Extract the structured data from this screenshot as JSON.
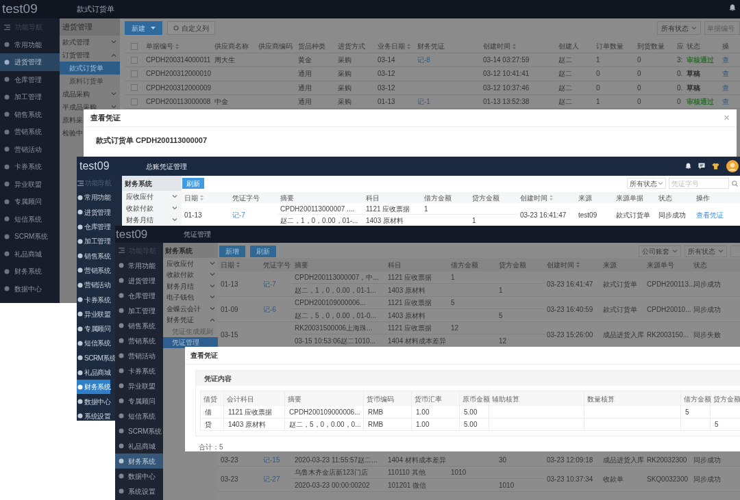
{
  "order_window": {
    "logo": "test09",
    "title": "款式订货单",
    "sidebar": [
      {
        "label": "功能导航",
        "kind": "toggle"
      },
      {
        "label": "常用功能",
        "kind": "link",
        "selected": false
      },
      {
        "label": "进货管理",
        "kind": "link",
        "selected": true
      },
      {
        "label": "仓库管理",
        "kind": "link",
        "selected": false
      },
      {
        "label": "加工管理",
        "kind": "link",
        "selected": false
      },
      {
        "label": "销售系统",
        "kind": "link",
        "selected": false
      },
      {
        "label": "营销系统",
        "kind": "link",
        "selected": false
      },
      {
        "label": "营销活动",
        "kind": "link",
        "selected": false
      },
      {
        "label": "卡券系统",
        "kind": "link",
        "selected": false
      },
      {
        "label": "异业联盟",
        "kind": "link",
        "selected": false
      },
      {
        "label": "专属顾问",
        "kind": "link",
        "selected": false
      },
      {
        "label": "短信系统",
        "kind": "link",
        "selected": false
      },
      {
        "label": "SCRM系统",
        "kind": "link",
        "selected": false
      },
      {
        "label": "礼品商城",
        "kind": "link",
        "selected": false
      },
      {
        "label": "财务系统",
        "kind": "link",
        "selected": false
      },
      {
        "label": "数据中心",
        "kind": "link",
        "selected": false
      }
    ],
    "submenu": {
      "header": "进货管理",
      "items": [
        {
          "label": "款式管理",
          "kind": "group",
          "expanded": false
        },
        {
          "label": "订货管理",
          "kind": "group",
          "expanded": true,
          "children": [
            {
              "label": "款式订货单",
              "selected": true
            },
            {
              "label": "原料订货单",
              "selected": false
            }
          ]
        },
        {
          "label": "成品采购",
          "kind": "group",
          "expanded": false
        },
        {
          "label": "半成品采购",
          "kind": "group",
          "expanded": false
        },
        {
          "label": "原料采",
          "kind": "link",
          "selected": false
        },
        {
          "label": "检验中",
          "kind": "link",
          "selected": false
        }
      ]
    },
    "new_button": "新建",
    "columns_button": "自定义列",
    "status_filter": "所有状态",
    "search_placeholder": "单据编号",
    "table": {
      "select_all_checked": false,
      "columns": [
        {
          "label": "单据编号",
          "sortable": true,
          "kind": "text"
        },
        {
          "label": "供应商名称",
          "sortable": false,
          "kind": "text"
        },
        {
          "label": "供应商编码",
          "sortable": false
        },
        {
          "label": "货品种类",
          "sortable": false,
          "kind": "text"
        },
        {
          "label": "进货方式",
          "sortable": false,
          "kind": "text"
        },
        {
          "label": "业务日期",
          "sortable": true,
          "kind": "text"
        },
        {
          "label": "财务凭证",
          "sortable": false,
          "kind": "link"
        },
        {
          "label": "创建时间",
          "sortable": true,
          "kind": "text"
        },
        {
          "label": "创建人",
          "sortable": false,
          "kind": "text"
        },
        {
          "label": "订单数量",
          "sortable": false,
          "kind": "text"
        },
        {
          "label": "到货数量",
          "sortable": false,
          "kind": "text"
        },
        {
          "label": "应",
          "sortable": false,
          "kind": "text"
        },
        {
          "label": "状态",
          "sortable": false,
          "kind": "status"
        },
        {
          "label": "操",
          "sortable": false,
          "kind": "link"
        }
      ],
      "rows": [
        {
          "checked": false,
          "number": "CPDH200314000011",
          "supplier_name": "周大生",
          "goods_type": "黄金",
          "purchase_mode": "采购",
          "business_date": "03-14",
          "voucher": "记-8",
          "created_at": "03-14 03:27:59",
          "creator": "赵二",
          "order_qty": "1",
          "arrived_qty": "0",
          "column_12": "3:",
          "status": {
            "text": "审核通过",
            "color": "#2f6e2f"
          },
          "column_14": "查"
        },
        {
          "checked": false,
          "number": "CPDH200312000010",
          "goods_type": "通用",
          "purchase_mode": "采购",
          "business_date": "03-12",
          "created_at": "03-12 10:41:41",
          "creator": "赵二",
          "order_qty": "0",
          "arrived_qty": "0",
          "column_12": "0.",
          "status": {
            "text": "草稿",
            "color": "#2e2e2e"
          },
          "column_14": "查"
        },
        {
          "checked": false,
          "number": "CPDH200312000009",
          "goods_type": "通用",
          "purchase_mode": "采购",
          "business_date": "03-12",
          "created_at": "03-12 10:37:46",
          "creator": "赵二",
          "order_qty": "0",
          "arrived_qty": "0",
          "column_12": "0.",
          "status": {
            "text": "草稿",
            "color": "#2e2e2e"
          },
          "column_14": "查"
        },
        {
          "checked": false,
          "number": "CPDH200113000008",
          "supplier_name": "中金",
          "goods_type": "通用",
          "purchase_mode": "采购",
          "business_date": "01-13",
          "voucher": "记-1",
          "created_at": "01-13 13:52:38",
          "creator": "赵二",
          "order_qty": "1",
          "arrived_qty": "0",
          "column_12": "0",
          "status": {
            "text": "审核通过",
            "color": "#2f6e2f"
          },
          "column_14": "查"
        }
      ]
    },
    "dialog": {
      "title": "查看凭证",
      "close": "×",
      "heading": "款式订货单 CPDH200113000007"
    }
  },
  "ledger_window": {
    "logo": "test09",
    "title": "总账凭证管理",
    "sidebar": [
      {
        "label": "功能导航",
        "kind": "toggle"
      },
      {
        "label": "常用功能",
        "kind": "link",
        "selected": false
      },
      {
        "label": "进货管理",
        "kind": "link",
        "selected": false
      },
      {
        "label": "仓库管理",
        "kind": "link",
        "selected": false
      },
      {
        "label": "加工管理",
        "kind": "link",
        "selected": false
      },
      {
        "label": "销售系统",
        "kind": "link",
        "selected": false
      },
      {
        "label": "营销系统",
        "kind": "link",
        "selected": false
      },
      {
        "label": "营销活动",
        "kind": "link",
        "selected": false
      },
      {
        "label": "卡券系统",
        "kind": "link",
        "selected": false
      },
      {
        "label": "异业联盟",
        "kind": "link",
        "selected": false
      },
      {
        "label": "专属顾问",
        "kind": "link",
        "selected": false
      },
      {
        "label": "短信系统",
        "kind": "link",
        "selected": false
      },
      {
        "label": "SCRM系统",
        "kind": "link",
        "selected": false
      },
      {
        "label": "礼品商城",
        "kind": "link",
        "selected": false
      },
      {
        "label": "财务系统",
        "kind": "link",
        "selected": true
      },
      {
        "label": "数据中心",
        "kind": "link",
        "selected": false
      },
      {
        "label": "系统设置",
        "kind": "link",
        "selected": false
      }
    ],
    "submenu": {
      "header": "财务系统",
      "items": [
        {
          "label": "应收应付",
          "kind": "group",
          "expanded": false
        },
        {
          "label": "收款付款",
          "kind": "group",
          "expanded": false
        },
        {
          "label": "财务月结",
          "kind": "group",
          "expanded": false
        }
      ]
    },
    "refresh_button": "刷新",
    "status_filter": "所有状态",
    "search_placeholder": "凭证字号",
    "table": {
      "columns": [
        {
          "label": "日期",
          "sortable": true,
          "kind": "text"
        },
        {
          "label": "凭证字号",
          "sortable": false,
          "kind": "link"
        },
        {
          "label": "摘要",
          "sortable": false,
          "kind": "line"
        },
        {
          "label": "科目",
          "sortable": false,
          "kind": "line"
        },
        {
          "label": "借方金额",
          "sortable": false,
          "kind": "line"
        },
        {
          "label": "贷方金额",
          "sortable": false,
          "kind": "line"
        },
        {
          "label": "创建时间",
          "sortable": true,
          "kind": "text"
        },
        {
          "label": "来源",
          "sortable": false,
          "kind": "text"
        },
        {
          "label": "来源单据",
          "sortable": false,
          "kind": "text"
        },
        {
          "label": "状态",
          "sortable": false,
          "kind": "text"
        },
        {
          "label": "操作",
          "sortable": false,
          "kind": "link"
        }
      ],
      "rows": [
        {
          "date": "01-13",
          "voucher": "记-7",
          "created_at": "03-23 16:41:47",
          "source": "test09",
          "source_doc": "款式订货单",
          "status": "同步成功",
          "action": "查看凭证",
          "lines": [
            {
              "summary": "CPDH200113000007 ....",
              "subject": "1121 应收票据",
              "debit": "1"
            },
            {
              "summary": "赵二，1，0，0.00，01-...",
              "subject": "1403 原材料",
              "credit": "1"
            }
          ]
        }
      ]
    }
  },
  "voucher_window": {
    "logo": "test09",
    "title": "凭证管理",
    "sidebar": [
      {
        "label": "功能导航",
        "kind": "toggle"
      },
      {
        "label": "常用功能",
        "kind": "link",
        "selected": false
      },
      {
        "label": "进货管理",
        "kind": "link",
        "selected": false
      },
      {
        "label": "仓库管理",
        "kind": "link",
        "selected": false
      },
      {
        "label": "加工管理",
        "kind": "link",
        "selected": false
      },
      {
        "label": "销售系统",
        "kind": "link",
        "selected": false
      },
      {
        "label": "营销系统",
        "kind": "link",
        "selected": false
      },
      {
        "label": "营销活动",
        "kind": "link",
        "selected": false
      },
      {
        "label": "卡券系统",
        "kind": "link",
        "selected": false
      },
      {
        "label": "异业联盟",
        "kind": "link",
        "selected": false
      },
      {
        "label": "专属顾问",
        "kind": "link",
        "selected": false
      },
      {
        "label": "短信系统",
        "kind": "link",
        "selected": false
      },
      {
        "label": "SCRM系统",
        "kind": "link",
        "selected": false
      },
      {
        "label": "礼品商城",
        "kind": "link",
        "selected": false
      },
      {
        "label": "财务系统",
        "kind": "link",
        "selected": true
      },
      {
        "label": "数据中心",
        "kind": "link",
        "selected": false
      },
      {
        "label": "系统设置",
        "kind": "link",
        "selected": false
      }
    ],
    "submenu": {
      "header": "财务系统",
      "items": [
        {
          "label": "应收应付",
          "kind": "group",
          "expanded": false
        },
        {
          "label": "收款付款",
          "kind": "group",
          "expanded": false
        },
        {
          "label": "财务月结",
          "kind": "group",
          "expanded": false
        },
        {
          "label": "电子钱包",
          "kind": "group",
          "expanded": false
        },
        {
          "label": "金蝶云会计",
          "kind": "group",
          "expanded": false
        },
        {
          "label": "财务凭证",
          "kind": "group",
          "expanded": true,
          "children": [
            {
              "label": "凭证生成规则",
              "selected": false
            },
            {
              "label": "凭证管理",
              "selected": true
            }
          ]
        }
      ]
    },
    "buttons": [
      "新增",
      "刷新"
    ],
    "filters": [
      "公司账套",
      "所有状态"
    ],
    "table": {
      "columns": [
        {
          "label": "日期",
          "sortable": true,
          "kind": "text"
        },
        {
          "label": "凭证字号",
          "sortable": false,
          "kind": "link"
        },
        {
          "label": "摘要",
          "sortable": false,
          "kind": "line"
        },
        {
          "label": "科目",
          "sortable": false,
          "kind": "line"
        },
        {
          "label": "借方金额",
          "sortable": false,
          "kind": "line"
        },
        {
          "label": "贷方金额",
          "sortable": false,
          "kind": "line"
        },
        {
          "label": "创建时间",
          "sortable": true,
          "kind": "text"
        },
        {
          "label": "来源",
          "sortable": false,
          "kind": "text"
        },
        {
          "label": "来源单号",
          "sortable": false,
          "kind": "text"
        },
        {
          "label": "状态",
          "sortable": false,
          "kind": "text"
        }
      ],
      "rows_above_dialog": [
        {
          "date": "01-13",
          "voucher": "记-7",
          "created_at": "03-23 16:41:47",
          "source": "款式订货单",
          "source_no": "CPDH200113...",
          "status": "同步成功",
          "lines": [
            {
              "summary": "CPDH200113000007，中...",
              "subject": "1121 应收票据",
              "debit": "1"
            },
            {
              "summary": "赵二，1，0，0.00，01-1...",
              "subject": "1403 原材料",
              "credit": "1"
            }
          ]
        },
        {
          "date": "01-09",
          "voucher": "记-6",
          "created_at": "03-23 16:40:59",
          "source": "款式订货单",
          "source_no": "CPDH20010...",
          "status": "同步成功",
          "lines": [
            {
              "summary": "CPDH200109000006...",
              "subject": "1121 应收票据",
              "debit": "5"
            },
            {
              "summary": "赵二，5，0，0.00，01-0...",
              "subject": "1403 原材料",
              "credit": "5"
            }
          ]
        },
        {
          "date": "03-15",
          "created_at": "03-23 15:26:00",
          "source": "成品进货入库",
          "source_no": "RK2003150...",
          "status": "同步失败",
          "lines": [
            {
              "summary": "RK20031500006上海珠...",
              "subject": "1121 应收票据",
              "debit": "12"
            },
            {
              "summary": "03-15 10:53:06赵二1010...",
              "subject": "1404 材料成本差异",
              "credit": "12"
            }
          ]
        }
      ],
      "rows_below_dialog": [
        {
          "date": "03-23",
          "voucher": "记-15",
          "created_at": "03-23 12:09:18",
          "source": "成品进货入库",
          "source_no": "RK20032300",
          "status": "同步成功",
          "lines": [
            {
              "summary": "2020-03-23 11:55:57赵二...",
              "subject": "1404 材料成本差异",
              "credit": "30"
            }
          ]
        },
        {
          "date": "03-23",
          "voucher": "记-27",
          "created_at": "03-23 10:37:34",
          "source": "收款单",
          "source_no": "SKQ0032300",
          "status": "同步成功",
          "lines": [
            {
              "summary": "乌鲁木齐金店新123门店",
              "subject": "110110 其他",
              "debit": "1010"
            },
            {
              "summary": "2020-03-23 00:00:00202",
              "subject": "101201 微信",
              "credit": "1010"
            }
          ]
        }
      ]
    },
    "dialog": {
      "title": "查看凭证",
      "panel_title": "凭证内容",
      "columns": [
        "借贷",
        "会计科目",
        "摘要",
        "货币编码",
        "货币汇率",
        "原币金额",
        "辅助核算",
        "数量核算",
        "借方金额",
        "贷方金额"
      ],
      "rows": [
        {
          "side": "借",
          "account": "1121 应收票据",
          "summary": "CPDH200109000006...",
          "currency": "RMB",
          "rate": "1.00",
          "amount": "5.00",
          "debit": "5"
        },
        {
          "side": "贷",
          "account": "1403 原材料",
          "summary": "赵二，5，0，0.00，0...",
          "currency": "RMB",
          "rate": "1.00",
          "amount": "5.00",
          "credit": "5"
        }
      ],
      "total": "合计：5"
    }
  }
}
